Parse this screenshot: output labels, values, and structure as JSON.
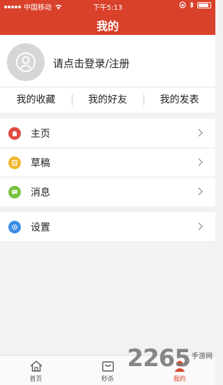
{
  "status_bar": {
    "carrier": "中国移动",
    "time": "下午5:13"
  },
  "header": {
    "title": "我的"
  },
  "profile": {
    "login_text": "请点击登录/注册"
  },
  "tabs": [
    {
      "label": "我的收藏"
    },
    {
      "label": "我的好友"
    },
    {
      "label": "我的发表"
    }
  ],
  "menu": [
    {
      "label": "主页",
      "icon": "home-icon",
      "color": "#e14b45"
    },
    {
      "label": "草稿",
      "icon": "draft-icon",
      "color": "#f2b62b"
    },
    {
      "label": "消息",
      "icon": "message-icon",
      "color": "#7ac142"
    }
  ],
  "settings": {
    "label": "设置",
    "icon": "settings-icon",
    "color": "#3a8ee6"
  },
  "footer": [
    {
      "label": "首页",
      "icon": "home-outline-icon"
    },
    {
      "label": "秒杀",
      "icon": "bag-icon"
    },
    {
      "label": "我的",
      "icon": "person-icon"
    }
  ],
  "watermark": {
    "number": "2265",
    "text": "手游网"
  },
  "colors": {
    "accent": "#d9412b"
  }
}
